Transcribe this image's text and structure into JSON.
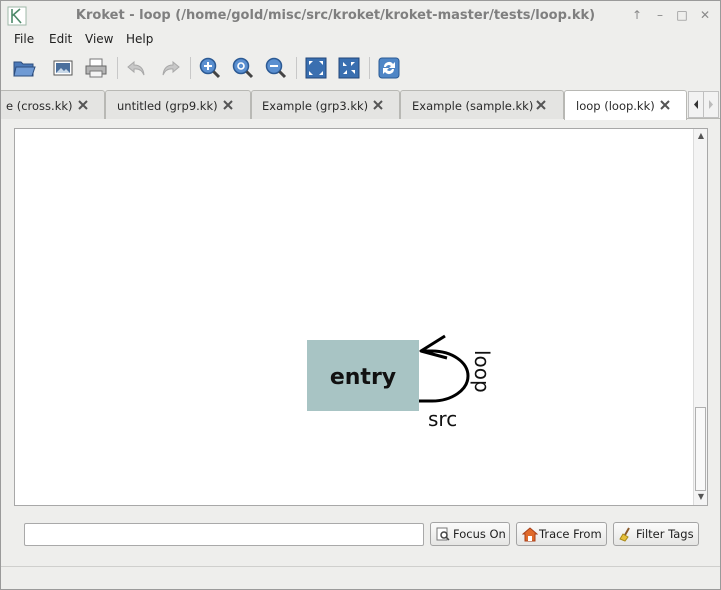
{
  "window": {
    "title": "Kroket - loop (/home/gold/misc/src/kroket/kroket-master/tests/loop.kk)",
    "controls": [
      "up-arrow-icon",
      "minimize-icon",
      "maximize-icon",
      "close-icon"
    ]
  },
  "menubar": {
    "items": [
      "File",
      "Edit",
      "View",
      "Help"
    ]
  },
  "toolbar": {
    "buttons": [
      "open-folder-icon",
      "export-image-icon",
      "print-icon",
      "undo-icon",
      "redo-icon",
      "zoom-in-icon",
      "zoom-reset-icon",
      "zoom-out-icon",
      "fit-screen-icon",
      "center-icon",
      "refresh-icon"
    ]
  },
  "tabs": [
    {
      "label": "e (cross.kk)",
      "active": false
    },
    {
      "label": "untitled (grp9.kk)",
      "active": false
    },
    {
      "label": "Example (grp3.kk)",
      "active": false
    },
    {
      "label": "Example (sample.kk)",
      "active": false
    },
    {
      "label": "loop (loop.kk)",
      "active": true
    }
  ],
  "graph": {
    "node": {
      "label": "entry",
      "fill": "#a8c4c4",
      "stroke": "#000000"
    },
    "edge": {
      "label": "loop",
      "port_label": "src"
    }
  },
  "search": {
    "value": "",
    "placeholder": ""
  },
  "buttons": {
    "focus_on": "Focus On",
    "trace_from": "Trace From",
    "filter_tags": "Filter Tags"
  },
  "status": {
    "text": ""
  }
}
